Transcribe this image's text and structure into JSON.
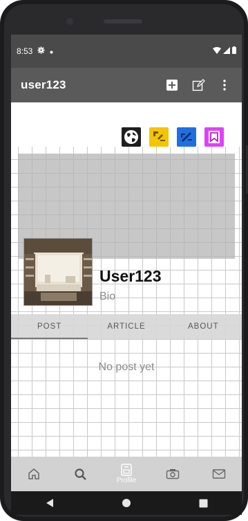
{
  "status_bar": {
    "time": "8:53"
  },
  "app_bar": {
    "title": "user123"
  },
  "profile": {
    "name": "User123",
    "bio": "Bio"
  },
  "tabs": [
    {
      "label": "POST"
    },
    {
      "label": "ARTICLE"
    },
    {
      "label": "ABOUT"
    }
  ],
  "empty_state": "No post yet",
  "bottom_nav": {
    "items": [
      {
        "icon": "home-icon"
      },
      {
        "icon": "search-icon"
      },
      {
        "icon": "profile-icon",
        "label": "Profile"
      },
      {
        "icon": "camera-icon"
      },
      {
        "icon": "mail-icon"
      }
    ]
  },
  "colors": {
    "status_bar": "#4a4a4a",
    "app_bar": "#5a5a5a",
    "social_globe": "#1e1e1e",
    "social_yellow": "#f6c300",
    "social_blue": "#1f6fe0",
    "social_pink": "#e040fb"
  }
}
